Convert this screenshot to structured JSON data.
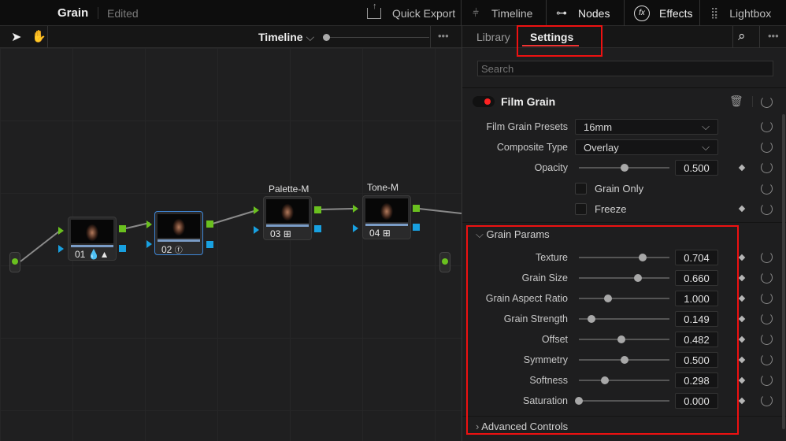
{
  "header": {
    "project_title": "Grain",
    "status": "Edited",
    "quick_export": "Quick Export",
    "timeline": "Timeline",
    "nodes": "Nodes",
    "effects": "Effects",
    "lightbox": "Lightbox"
  },
  "node_toolbar": {
    "timeline_dropdown": "Timeline",
    "more": "•••"
  },
  "nodes": [
    {
      "number": "01",
      "title": "",
      "icon": "color-warper-icon",
      "selected": false
    },
    {
      "number": "02",
      "title": "",
      "icon": "fx-icon",
      "selected": true
    },
    {
      "number": "03",
      "title": "Palette-M",
      "icon": "grid-icon",
      "selected": false
    },
    {
      "number": "04",
      "title": "Tone-M",
      "icon": "grid-icon",
      "selected": false
    }
  ],
  "panel": {
    "tabs": [
      "Library",
      "Settings"
    ],
    "active_tab": "Settings",
    "search_placeholder": "Search",
    "more": "•••"
  },
  "effect": {
    "name": "Film Grain",
    "enabled": true,
    "presets_label": "Film Grain Presets",
    "presets_value": "16mm",
    "composite_label": "Composite Type",
    "composite_value": "Overlay",
    "opacity_label": "Opacity",
    "opacity_value": "0.500",
    "opacity_fraction": 0.5,
    "grain_only_label": "Grain Only",
    "freeze_label": "Freeze"
  },
  "grain_params": {
    "title": "Grain Params",
    "params": [
      {
        "label": "Texture",
        "value": "0.704",
        "fraction": 0.7
      },
      {
        "label": "Grain Size",
        "value": "0.660",
        "fraction": 0.65
      },
      {
        "label": "Grain Aspect Ratio",
        "value": "1.000",
        "fraction": 0.32
      },
      {
        "label": "Grain Strength",
        "value": "0.149",
        "fraction": 0.14
      },
      {
        "label": "Offset",
        "value": "0.482",
        "fraction": 0.47
      },
      {
        "label": "Symmetry",
        "value": "0.500",
        "fraction": 0.5
      },
      {
        "label": "Softness",
        "value": "0.298",
        "fraction": 0.29
      },
      {
        "label": "Saturation",
        "value": "0.000",
        "fraction": 0.0
      }
    ]
  },
  "advanced": {
    "title": "Advanced Controls"
  },
  "colors": {
    "highlight": "#ee1111",
    "accent": "#3f86d6",
    "pin_green": "#6ac01f",
    "pin_blue": "#18a0e0"
  }
}
